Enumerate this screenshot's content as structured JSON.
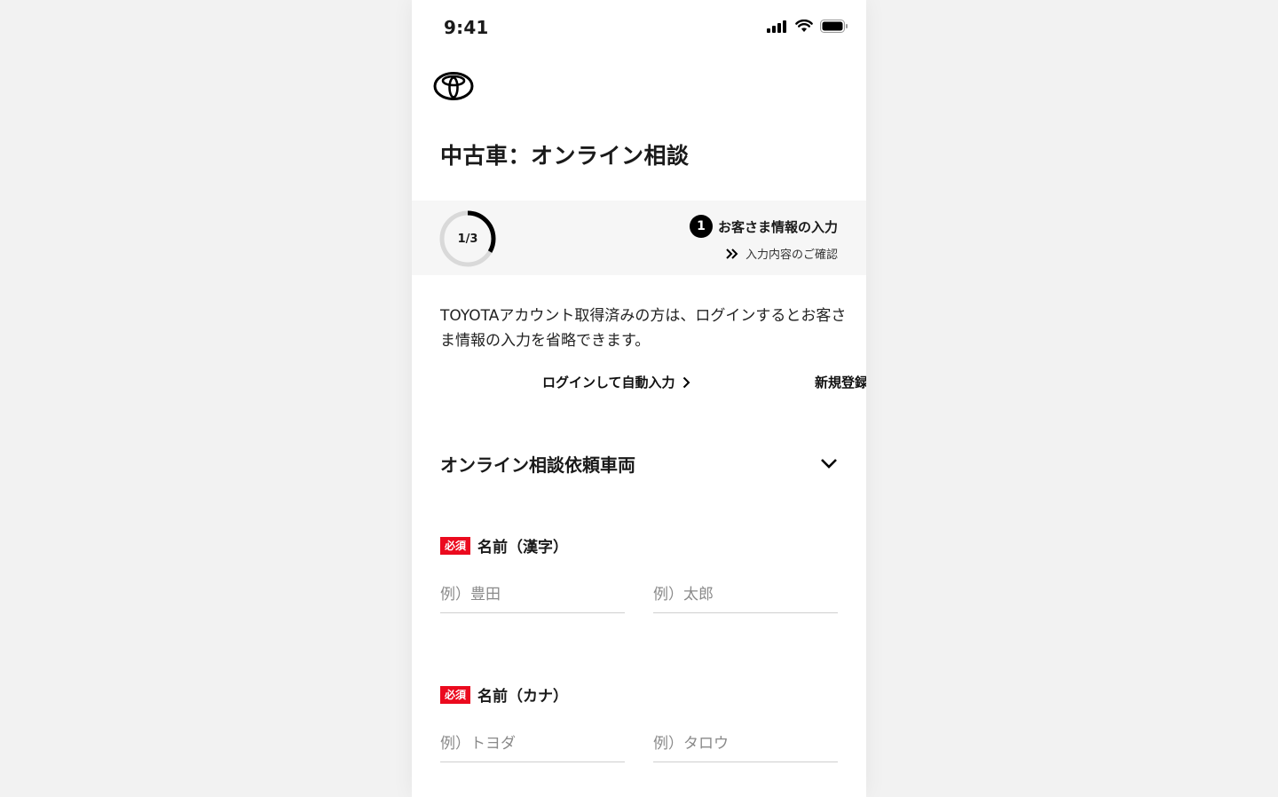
{
  "status_bar": {
    "time": "9:41"
  },
  "page_title": "中古車：オンライン相談",
  "progress": {
    "fraction": 0.3333,
    "label": "1/3",
    "current_step_number": "1",
    "current_step_label": "お客さま情報の入力",
    "next_step_label": "入力内容のご確認"
  },
  "intro_text": "TOYOTAアカウント取得済みの方は、ログインするとお客さま情報の入力を省略できます。",
  "links": {
    "login_autofill": "ログインして自動入力",
    "register": "新規登録"
  },
  "vehicle_section": {
    "title": "オンライン相談依頼車両"
  },
  "form": {
    "required_badge": "必須",
    "name_kanji": {
      "label": "名前（漢字）",
      "last_placeholder": "例）豊田",
      "first_placeholder": "例）太郎"
    },
    "name_kana": {
      "label": "名前（カナ）",
      "last_placeholder": "例）トヨダ",
      "first_placeholder": "例）タロウ"
    }
  },
  "colors": {
    "required_red": "#eb0a1e",
    "progress_track": "#d9d9d9",
    "progress_fill": "#000000",
    "band_background": "#f6f6f6"
  }
}
